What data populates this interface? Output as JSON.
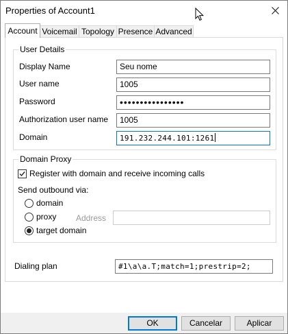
{
  "window": {
    "title": "Properties of Account1"
  },
  "tabs": [
    {
      "label": "Account",
      "active": true
    },
    {
      "label": "Voicemail",
      "active": false
    },
    {
      "label": "Topology",
      "active": false
    },
    {
      "label": "Presence",
      "active": false
    },
    {
      "label": "Advanced",
      "active": false
    }
  ],
  "user_details": {
    "title": "User Details",
    "display_name": {
      "label": "Display Name",
      "value": "Seu nome"
    },
    "user_name": {
      "label": "User name",
      "value": "1005"
    },
    "password": {
      "label": "Password",
      "value": "••••••••••••••••"
    },
    "auth_user_name": {
      "label": "Authorization user name",
      "value": "1005"
    },
    "domain": {
      "label": "Domain",
      "value": "191.232.244.101:1261"
    }
  },
  "domain_proxy": {
    "title": "Domain Proxy",
    "register_checkbox": {
      "label": "Register with domain and receive incoming calls",
      "checked": true
    },
    "send_outbound_label": "Send outbound via:",
    "options": {
      "domain": {
        "label": "domain",
        "selected": false
      },
      "proxy": {
        "label": "proxy",
        "selected": false
      },
      "target_domain": {
        "label": "target domain",
        "selected": true
      }
    },
    "address": {
      "label": "Address",
      "value": ""
    }
  },
  "dialing_plan": {
    "label": "Dialing plan",
    "value": "#1\\a\\a.T;match=1;prestrip=2;"
  },
  "buttons": {
    "ok": "OK",
    "cancel": "Cancelar",
    "apply": "Aplicar"
  },
  "icons": {
    "close": "close-icon",
    "cursor": "mouse-pointer-icon",
    "check": "checkmark-icon"
  }
}
